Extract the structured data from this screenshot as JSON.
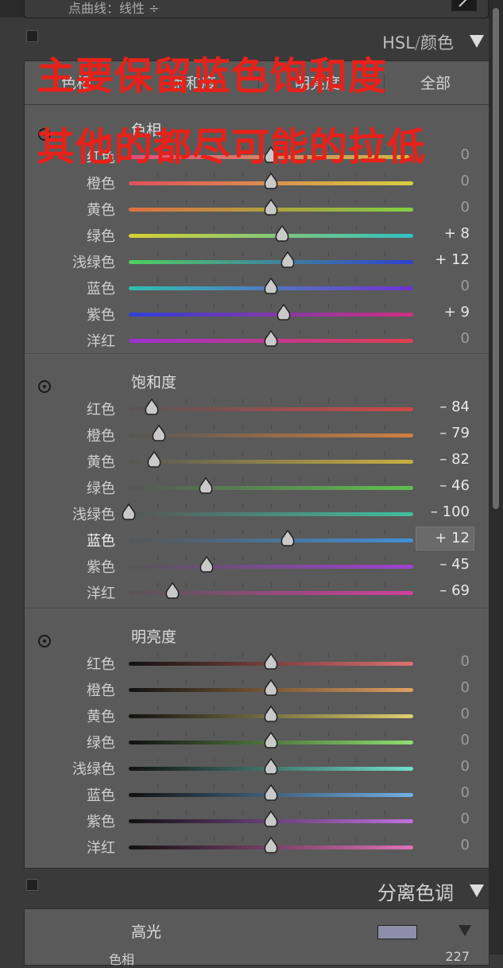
{
  "top_field": {
    "text": "点曲线：线性 ÷"
  },
  "hsl_panel": {
    "title_a": "HSL",
    "title_sep": "/",
    "title_b": "颜色",
    "tabs": [
      "色相",
      "饱和度",
      "明亮度",
      "全部"
    ]
  },
  "overlay": {
    "line1": "主要保留蓝色饱和度",
    "line2": "其他的都尽可能的拉低",
    "color": "#e8211a"
  },
  "sections": [
    {
      "title": "色相",
      "rows": [
        {
          "label": "红色",
          "value": "0",
          "num": 0,
          "track": [
            "#e04a80",
            "#c9c040"
          ]
        },
        {
          "label": "橙色",
          "value": "0",
          "num": 0,
          "track": [
            "#e0505a",
            "#d6d040"
          ]
        },
        {
          "label": "黄色",
          "value": "0",
          "num": 0,
          "track": [
            "#e07040",
            "#80d040"
          ]
        },
        {
          "label": "绿色",
          "value": "+ 8",
          "num": 8,
          "track": [
            "#d8d030",
            "#30c0c0"
          ]
        },
        {
          "label": "浅绿色",
          "value": "+ 12",
          "num": 12,
          "track": [
            "#50d060",
            "#3040d0"
          ]
        },
        {
          "label": "蓝色",
          "value": "0",
          "num": 0,
          "track": [
            "#30c0b0",
            "#7030d0"
          ]
        },
        {
          "label": "紫色",
          "value": "+ 9",
          "num": 9,
          "track": [
            "#3040d8",
            "#d03080"
          ]
        },
        {
          "label": "洋红",
          "value": "0",
          "num": 0,
          "track": [
            "#a030d0",
            "#e04050"
          ]
        }
      ]
    },
    {
      "title": "饱和度",
      "rows": [
        {
          "label": "红色",
          "value": "– 84",
          "num": -84,
          "track": [
            "#555",
            "#d04848"
          ]
        },
        {
          "label": "橙色",
          "value": "– 79",
          "num": -79,
          "track": [
            "#555",
            "#d08040"
          ]
        },
        {
          "label": "黄色",
          "value": "– 82",
          "num": -82,
          "track": [
            "#555",
            "#c8b040"
          ]
        },
        {
          "label": "绿色",
          "value": "– 46",
          "num": -46,
          "track": [
            "#555",
            "#60c050"
          ]
        },
        {
          "label": "浅绿色",
          "value": "– 100",
          "num": -100,
          "track": [
            "#555",
            "#40c0a0"
          ]
        },
        {
          "label": "蓝色",
          "value": "+ 12",
          "num": 12,
          "track": [
            "#555",
            "#4090d8"
          ],
          "active": true
        },
        {
          "label": "紫色",
          "value": "– 45",
          "num": -45,
          "track": [
            "#555",
            "#a040d0"
          ]
        },
        {
          "label": "洋红",
          "value": "– 69",
          "num": -69,
          "track": [
            "#555",
            "#d040a0"
          ]
        }
      ]
    },
    {
      "title": "明亮度",
      "rows": [
        {
          "label": "红色",
          "value": "0",
          "num": 0,
          "track": [
            "#111",
            "#e07070"
          ]
        },
        {
          "label": "橙色",
          "value": "0",
          "num": 0,
          "track": [
            "#111",
            "#e0a060"
          ]
        },
        {
          "label": "黄色",
          "value": "0",
          "num": 0,
          "track": [
            "#111",
            "#e0d070"
          ]
        },
        {
          "label": "绿色",
          "value": "0",
          "num": 0,
          "track": [
            "#111",
            "#90e070"
          ]
        },
        {
          "label": "浅绿色",
          "value": "0",
          "num": 0,
          "track": [
            "#111",
            "#70e0c8"
          ]
        },
        {
          "label": "蓝色",
          "value": "0",
          "num": 0,
          "track": [
            "#111",
            "#70b0e8"
          ]
        },
        {
          "label": "紫色",
          "value": "0",
          "num": 0,
          "track": [
            "#111",
            "#c070e0"
          ]
        },
        {
          "label": "洋红",
          "value": "0",
          "num": 0,
          "track": [
            "#111",
            "#e070b8"
          ]
        }
      ]
    }
  ],
  "split_toning": {
    "title": "分离色调",
    "highlight_label": "高光",
    "swatch_color": "#8e8ea8",
    "row2_label": "色相",
    "row2_value": "227"
  }
}
